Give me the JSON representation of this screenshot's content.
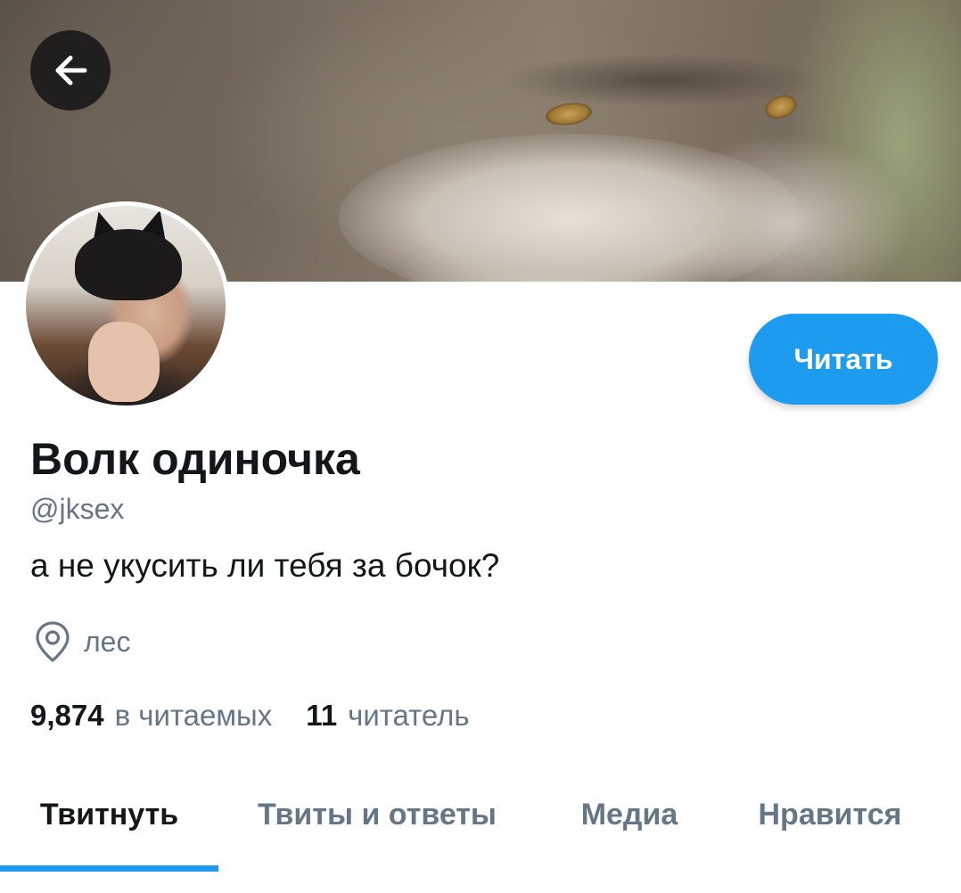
{
  "header": {
    "back_icon": "arrow-left-icon"
  },
  "profile": {
    "display_name": "Волк одиночка",
    "handle": "@jksex",
    "bio": "а не укусить ли тебя за бочок?",
    "location": "лес",
    "location_icon": "map-pin-icon",
    "follow_label": "Читать"
  },
  "stats": {
    "following_count": "9,874",
    "following_label": "в читаемых",
    "followers_count": "11",
    "followers_label": "читатель"
  },
  "tabs": [
    {
      "label": "Твитнуть",
      "active": true
    },
    {
      "label": "Твиты и ответы",
      "active": false
    },
    {
      "label": "Медиа",
      "active": false
    },
    {
      "label": "Нравится",
      "active": false
    }
  ],
  "colors": {
    "accent": "#1d9bf0",
    "primary_text": "#14171a",
    "secondary_text": "#657786"
  }
}
